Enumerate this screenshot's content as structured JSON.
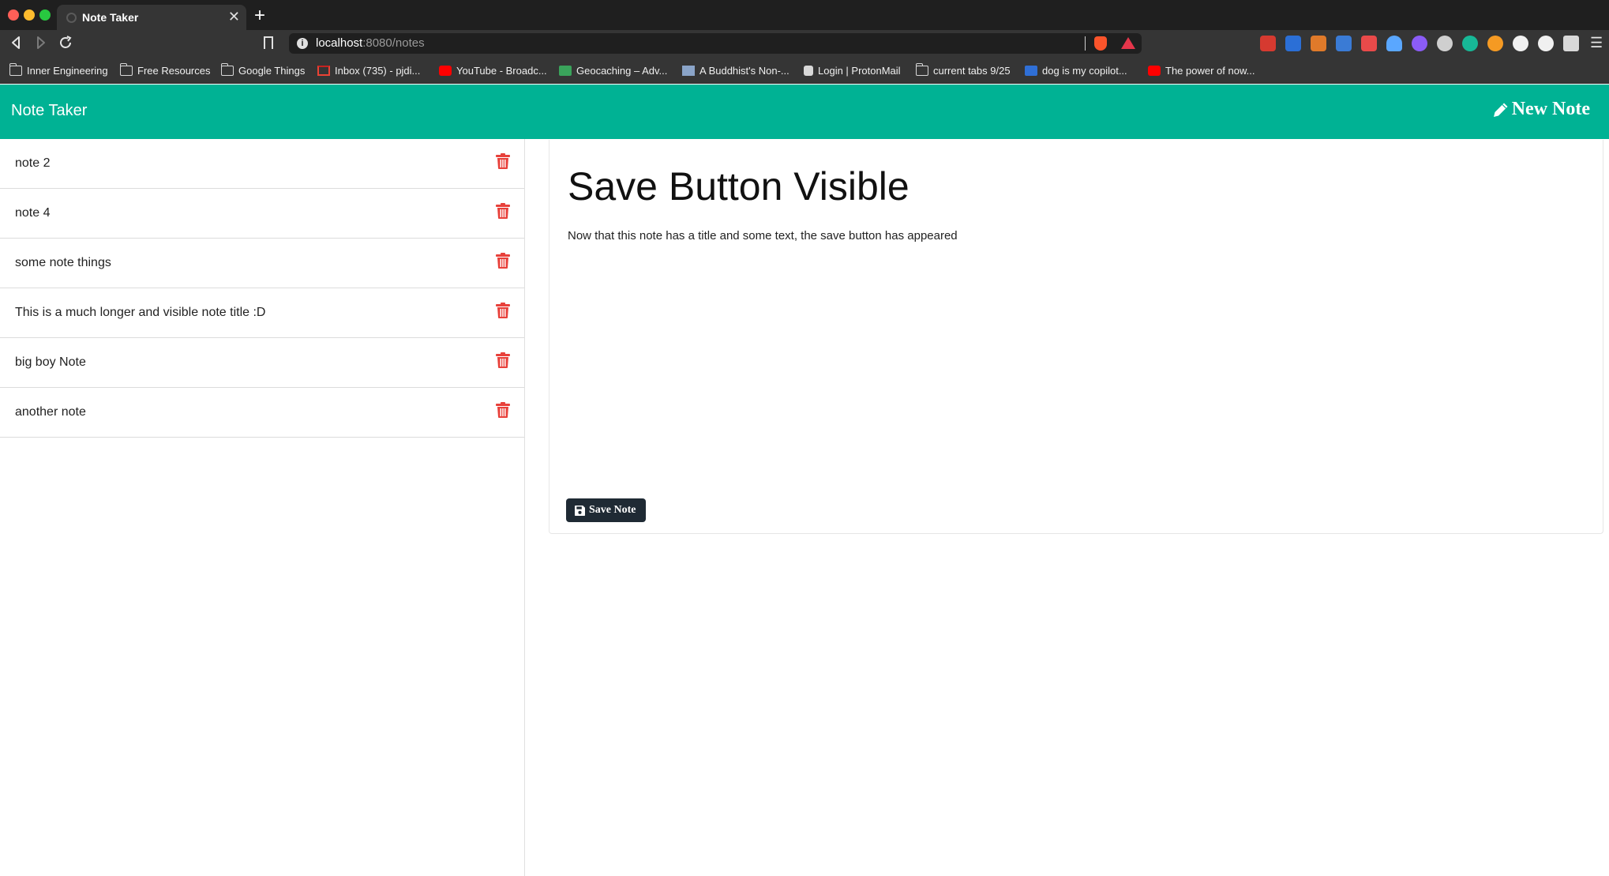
{
  "browser": {
    "tab": {
      "title": "Note Taker"
    },
    "url": {
      "host": "localhost",
      "path": ":8080/notes"
    },
    "bookmarks": [
      {
        "label": "Inner Engineering",
        "icon": "folder-icon"
      },
      {
        "label": "Free Resources",
        "icon": "folder-icon"
      },
      {
        "label": "Google Things",
        "icon": "folder-icon"
      },
      {
        "label": "Inbox (735) - pjdi...",
        "icon": "gmail-icon"
      },
      {
        "label": "YouTube - Broadc...",
        "icon": "youtube-icon"
      },
      {
        "label": "Geocaching – Adv...",
        "icon": "geocaching-icon"
      },
      {
        "label": "A Buddhist's Non-...",
        "icon": "image-icon"
      },
      {
        "label": "Login | ProtonMail",
        "icon": "lock-icon"
      },
      {
        "label": "current tabs 9/25",
        "icon": "folder-icon"
      },
      {
        "label": "dog is my copilot...",
        "icon": "d-icon"
      },
      {
        "label": "The power of now...",
        "icon": "youtube-icon"
      }
    ]
  },
  "app": {
    "brand": "Note Taker",
    "new_note_label": "New Note",
    "notes": [
      {
        "title": "note 2"
      },
      {
        "title": "note 4"
      },
      {
        "title": "some note things"
      },
      {
        "title": "This is a much longer and visible note title :D"
      },
      {
        "title": "big boy Note"
      },
      {
        "title": "another note"
      }
    ],
    "active_note": {
      "title": "Save Button Visible",
      "text": "Now that this note has a title and some text, the save button has appeared"
    },
    "save_label": "Save Note"
  },
  "colors": {
    "header": "#00b294",
    "trash": "#e8413b",
    "save_button": "#1f2a34"
  }
}
